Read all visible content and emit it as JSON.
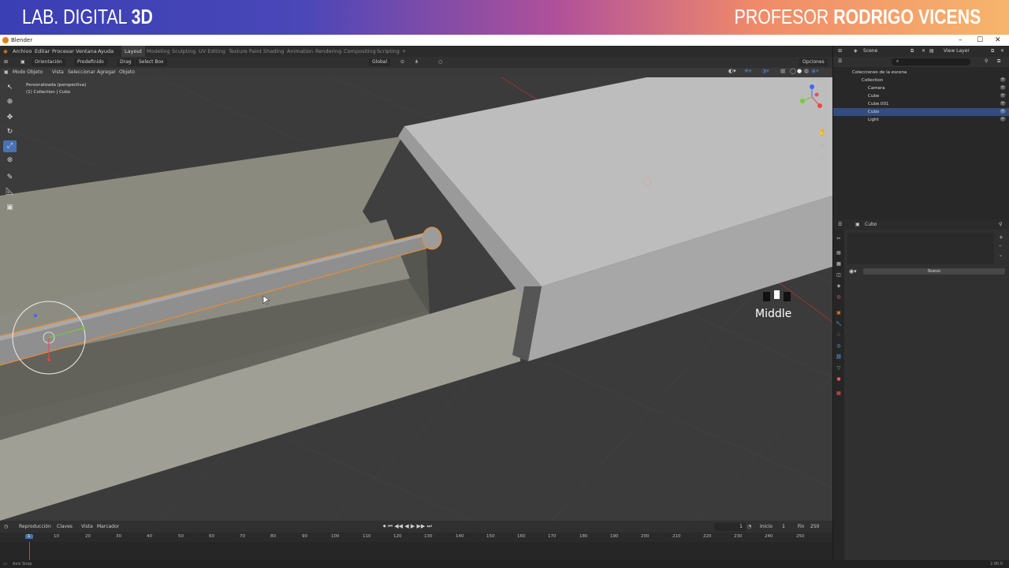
{
  "banner": {
    "left_light": "LAB. DIGITAL ",
    "left_bold": "3D",
    "right_light": "PROFESOR ",
    "right_bold": "RODRIGO VICENS"
  },
  "window": {
    "title": "Blender",
    "minimize": "–",
    "maximize": "☐",
    "close": "✕"
  },
  "menu": {
    "items": [
      "Archivo",
      "Editar",
      "Procesar",
      "Ventana",
      "Ayuda"
    ]
  },
  "workspaces": [
    "Layout",
    "Modeling",
    "Sculpting",
    "UV Editing",
    "Texture Paint",
    "Shading",
    "Animation",
    "Rendering",
    "Compositing",
    "Scripting",
    "+"
  ],
  "scene": {
    "name": "Scene",
    "view_layer": "View Layer"
  },
  "header": {
    "orientation": "Orientación",
    "orientation_value": "Predefinido",
    "drag": "Drag",
    "drag_value": "Select Box",
    "transform": "Global",
    "options": "Opciones"
  },
  "header2": {
    "mode": "Modo Objeto",
    "view": "Vista",
    "select": "Seleccionar",
    "add": "Agregar",
    "object": "Objeto"
  },
  "viewport": {
    "view_name": "Personalizada (perspectiva)",
    "collection_info": "(1) Collection | Cubo",
    "overlay_label": "Middle"
  },
  "outliner": {
    "root": "Colecciones de la escena",
    "items": [
      {
        "label": "Collection",
        "indent": 1,
        "selected": false
      },
      {
        "label": "Camera",
        "indent": 2,
        "selected": false
      },
      {
        "label": "Cube",
        "indent": 2,
        "selected": false
      },
      {
        "label": "Cube.001",
        "indent": 2,
        "selected": false
      },
      {
        "label": "Cubo",
        "indent": 2,
        "selected": true
      },
      {
        "label": "Light",
        "indent": 2,
        "selected": false
      }
    ]
  },
  "properties": {
    "object_name": "Cubo",
    "new_button": "Nuevo"
  },
  "timeline": {
    "playback": "Reproducción",
    "keys": "Claves",
    "view": "Vista",
    "marker": "Marcador",
    "current_frame": "1",
    "start_label": "Inicio",
    "start": "1",
    "end_label": "Fin",
    "end": "250",
    "ruler": [
      "1",
      "10",
      "20",
      "30",
      "40",
      "50",
      "60",
      "70",
      "80",
      "90",
      "100",
      "110",
      "120",
      "130",
      "140",
      "150",
      "160",
      "170",
      "180",
      "190",
      "200",
      "210",
      "220",
      "230",
      "240",
      "250"
    ]
  },
  "status": {
    "left": "Axis Snap",
    "version": "2.90.0"
  },
  "colors": {
    "accent": "#4772b3",
    "selection_outline": "#f08c2e",
    "viewport_bg": "#393939"
  }
}
